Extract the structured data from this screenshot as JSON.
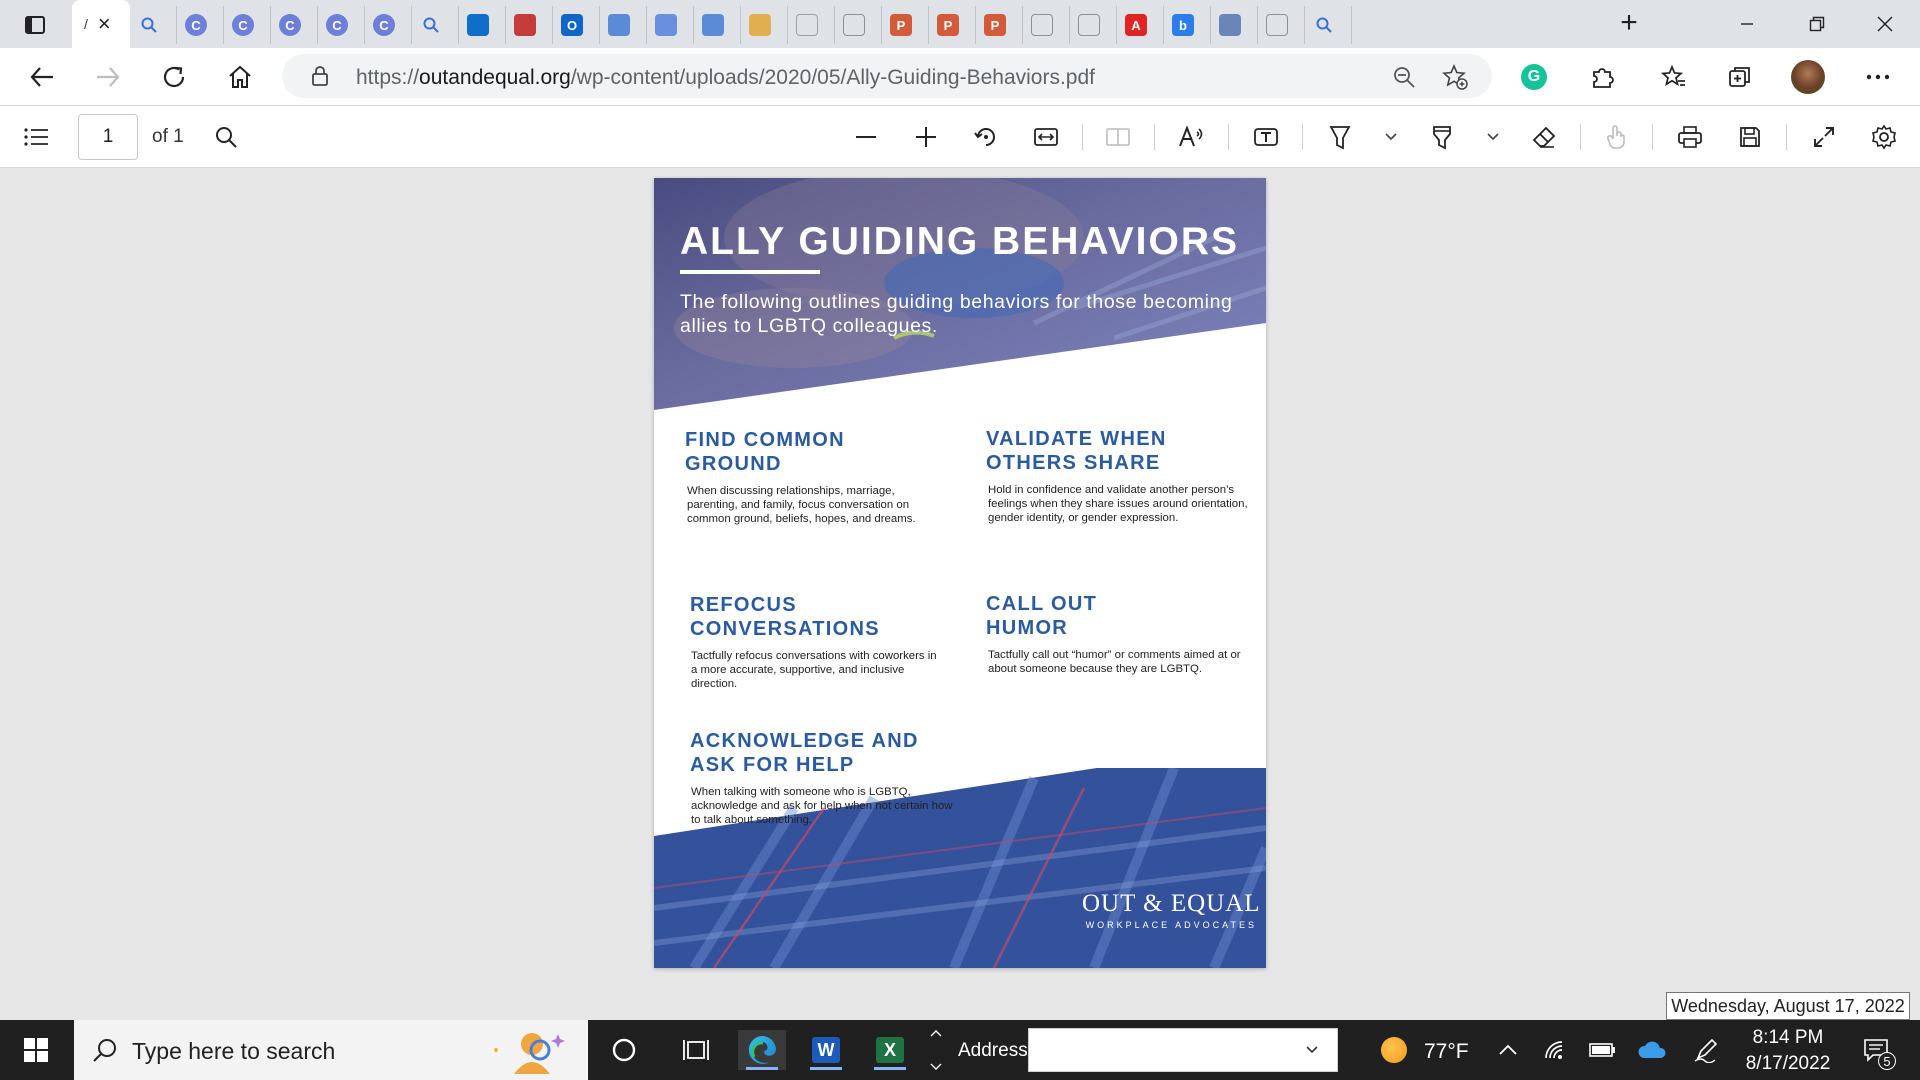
{
  "browser": {
    "active_tab_label": "/",
    "url_prefix": "https://",
    "url_host": "outandequal.org",
    "url_path": "/wp-content/uploads/2020/05/Ally-Guiding-Behaviors.pdf",
    "tabs": [
      {
        "icon": "search-icon"
      },
      {
        "icon": "copilot-icon",
        "glyph": "C"
      },
      {
        "icon": "copilot-icon",
        "glyph": "C"
      },
      {
        "icon": "copilot-icon",
        "glyph": "C"
      },
      {
        "icon": "copilot-icon",
        "glyph": "C"
      },
      {
        "icon": "copilot-icon",
        "glyph": "C"
      },
      {
        "icon": "search-icon"
      },
      {
        "icon": "blue-square-icon"
      },
      {
        "icon": "shield-icon"
      },
      {
        "icon": "outlook-icon",
        "glyph": "O"
      },
      {
        "icon": "document-icon"
      },
      {
        "icon": "video-icon"
      },
      {
        "icon": "document-icon"
      },
      {
        "icon": "image-icon"
      },
      {
        "icon": "globe-icon"
      },
      {
        "icon": "page-icon"
      },
      {
        "icon": "powerpoint-icon",
        "glyph": "P"
      },
      {
        "icon": "powerpoint-icon",
        "glyph": "P"
      },
      {
        "icon": "powerpoint-icon",
        "glyph": "P"
      },
      {
        "icon": "page-icon"
      },
      {
        "icon": "page-icon"
      },
      {
        "icon": "acrobat-icon",
        "glyph": "A"
      },
      {
        "icon": "bing-icon",
        "glyph": "b"
      },
      {
        "icon": "screenshot-icon"
      },
      {
        "icon": "page-icon"
      },
      {
        "icon": "search-icon"
      }
    ]
  },
  "pdf_toolbar": {
    "page_number": "1",
    "page_total": "of 1"
  },
  "document": {
    "title": "ALLY GUIDING BEHAVIORS",
    "subtitle": "The following outlines guiding behaviors for those becoming allies to LGBTQ colleagues.",
    "sections": [
      {
        "heading": "FIND COMMON GROUND",
        "body": "When discussing relationships, marriage, parenting, and family, focus conversation on common ground, beliefs, hopes, and dreams."
      },
      {
        "heading": "VALIDATE WHEN OTHERS SHARE",
        "body": "Hold in confidence and validate another person’s feelings when they share issues around orientation, gender identity, or gender expression."
      },
      {
        "heading": "REFOCUS CONVERSATIONS",
        "body": "Tactfully refocus conversations with coworkers in a more accurate, supportive, and inclusive direction."
      },
      {
        "heading": "CALL OUT HUMOR",
        "body": "Tactfully call out “humor” or comments aimed at or about someone because they are LGBTQ."
      },
      {
        "heading": "ACKNOWLEDGE AND ASK FOR HELP",
        "body": "When talking with someone who is LGBTQ, acknowledge and ask for help when not certain how to talk about something."
      }
    ],
    "logo_main": "OUT & EQUAL",
    "logo_sub": "WORKPLACE ADVOCATES"
  },
  "tooltip": {
    "text": "Wednesday, August 17, 2022"
  },
  "taskbar": {
    "search_placeholder": "Type here to search",
    "address_label": "Address",
    "address_value": "",
    "temperature": "77°F",
    "time": "8:14 PM",
    "date": "8/17/2022",
    "notification_count": "5"
  },
  "colors": {
    "accent_blue": "#2a5aa0",
    "hero_purple": "#5d5e95",
    "footer_blue": "#2f4f9a",
    "taskbar": "#202020"
  }
}
